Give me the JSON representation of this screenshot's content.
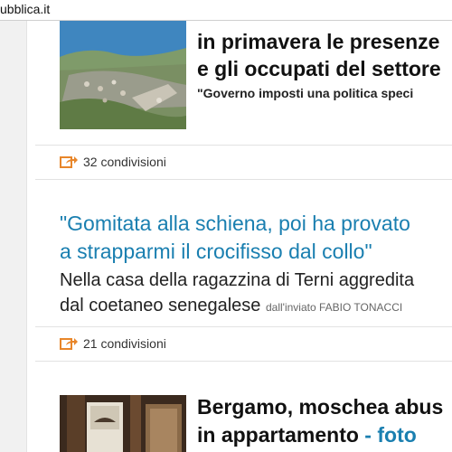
{
  "browser": {
    "url_fragment": "ubblica.it"
  },
  "articles": [
    {
      "headline_line1": "in primavera le presenze",
      "headline_line2": "e gli occupati del settore",
      "subtitle": "\"Governo imposti una politica speci",
      "shares": "32 condivisioni",
      "thumb_icon": "coastal-town-photo"
    },
    {
      "headline_line1": "\"Gomitata alla schiena, poi ha provato",
      "headline_line2": "a strapparmi il crocifisso dal collo\"",
      "summary_line1": "Nella casa della ragazzina di Terni aggredita",
      "summary_line2": "dal coetaneo senegalese",
      "byline": "dall'inviato FABIO TONACCI",
      "shares": "21 condivisioni"
    },
    {
      "headline_line1": "Bergamo, moschea abus",
      "headline_line2_text": "in appartamento",
      "headline_line2_link": " - foto",
      "thumb_icon": "mosque-interior-photo"
    }
  ],
  "colors": {
    "link_blue": "#1a7fb0",
    "share_orange": "#e8862a"
  }
}
